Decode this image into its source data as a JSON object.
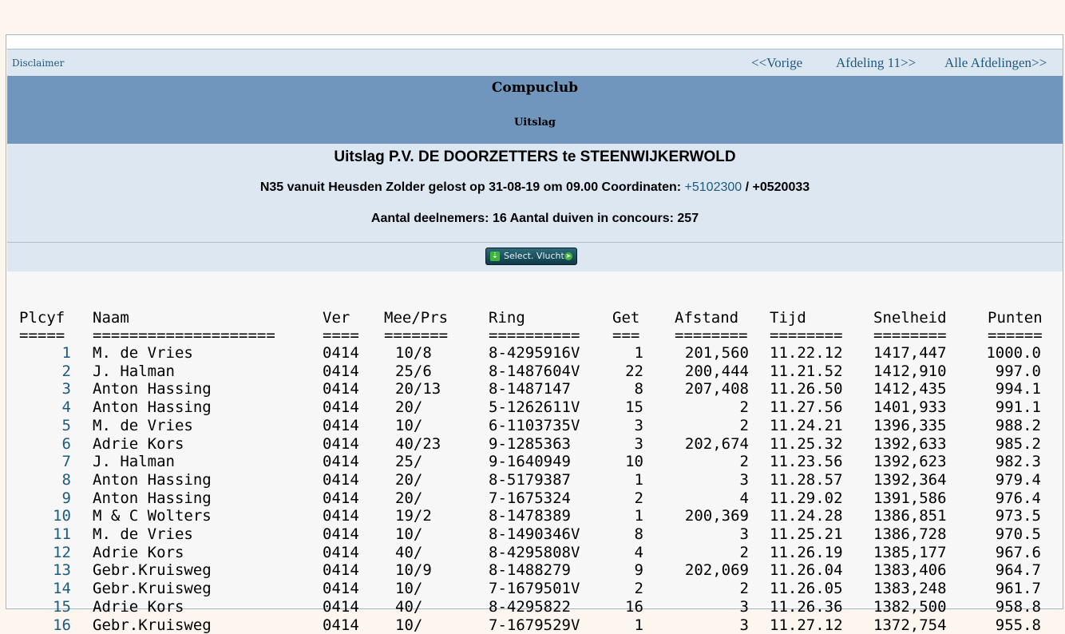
{
  "nav": {
    "disclaimer": "Disclaimer",
    "prev": "<<Vorige",
    "afdeling": "Afdeling 11>>",
    "all": "Alle Afdelingen>>"
  },
  "header": {
    "club": "Compuclub",
    "subtitle": "Uitslag"
  },
  "race": {
    "title": "Uitslag P.V. DE DOORZETTERS te STEENWIJKERWOLD",
    "line_prefix": "N35 vanuit Heusden Zolder gelost op 31-08-19 om 09.00 Coordinaten: ",
    "coord_lat": "+5102300",
    "line_suffix": " / +0520033",
    "counts": "Aantal deelnemers: 16 Aantal duiven in concours: 257"
  },
  "select_button": {
    "label": "Select. Vlucht"
  },
  "table": {
    "headers": [
      "Plcyf",
      "Naam",
      "Ver",
      "Mee/Prs",
      "Ring",
      "Get",
      "Afstand",
      "Tijd",
      "Snelheid",
      "Punten"
    ],
    "underlines": [
      "=====",
      "====================",
      "====",
      "=======",
      "==========",
      "===",
      "========",
      "========",
      "========",
      "======"
    ],
    "rows": [
      [
        "1",
        "M. de Vries",
        "0414",
        "10/8",
        "8-4295916V",
        "1",
        "201,560",
        "11.22.12",
        "1417,447",
        "1000.0"
      ],
      [
        "2",
        "J. Halman",
        "0414",
        "25/6",
        "8-1487604V",
        "22",
        "200,444",
        "11.21.52",
        "1412,910",
        "997.0"
      ],
      [
        "3",
        "Anton Hassing",
        "0414",
        "20/13",
        "8-1487147",
        "8",
        "207,408",
        "11.26.50",
        "1412,435",
        "994.1"
      ],
      [
        "4",
        "Anton Hassing",
        "0414",
        "20/",
        "5-1262611V",
        "15",
        "2",
        "11.27.56",
        "1401,933",
        "991.1"
      ],
      [
        "5",
        "M. de Vries",
        "0414",
        "10/",
        "6-1103735V",
        "3",
        "2",
        "11.24.21",
        "1396,335",
        "988.2"
      ],
      [
        "6",
        "Adrie Kors",
        "0414",
        "40/23",
        "9-1285363",
        "3",
        "202,674",
        "11.25.32",
        "1392,633",
        "985.2"
      ],
      [
        "7",
        "J. Halman",
        "0414",
        "25/",
        "9-1640949",
        "10",
        "2",
        "11.23.56",
        "1392,623",
        "982.3"
      ],
      [
        "8",
        "Anton Hassing",
        "0414",
        "20/",
        "8-5179387",
        "1",
        "3",
        "11.28.57",
        "1392,364",
        "979.4"
      ],
      [
        "9",
        "Anton Hassing",
        "0414",
        "20/",
        "7-1675324",
        "2",
        "4",
        "11.29.02",
        "1391,586",
        "976.4"
      ],
      [
        "10",
        "M & C Wolters",
        "0414",
        "19/2",
        "8-1478389",
        "1",
        "200,369",
        "11.24.28",
        "1386,851",
        "973.5"
      ],
      [
        "11",
        "M. de Vries",
        "0414",
        "10/",
        "8-1490346V",
        "8",
        "3",
        "11.25.21",
        "1386,728",
        "970.5"
      ],
      [
        "12",
        "Adrie Kors",
        "0414",
        "40/",
        "8-4295808V",
        "4",
        "2",
        "11.26.19",
        "1385,177",
        "967.6"
      ],
      [
        "13",
        "Gebr.Kruisweg",
        "0414",
        "10/9",
        "8-1488279",
        "9",
        "202,069",
        "11.26.04",
        "1383,406",
        "964.7"
      ],
      [
        "14",
        "Gebr.Kruisweg",
        "0414",
        "10/",
        "7-1679501V",
        "2",
        "2",
        "11.26.05",
        "1383,248",
        "961.7"
      ],
      [
        "15",
        "Adrie Kors",
        "0414",
        "40/",
        "8-4295822",
        "16",
        "3",
        "11.26.36",
        "1382,500",
        "958.8"
      ],
      [
        "16",
        "Gebr.Kruisweg",
        "0414",
        "10/",
        "7-1679529V",
        "1",
        "3",
        "11.27.12",
        "1372,754",
        "955.8"
      ]
    ]
  }
}
